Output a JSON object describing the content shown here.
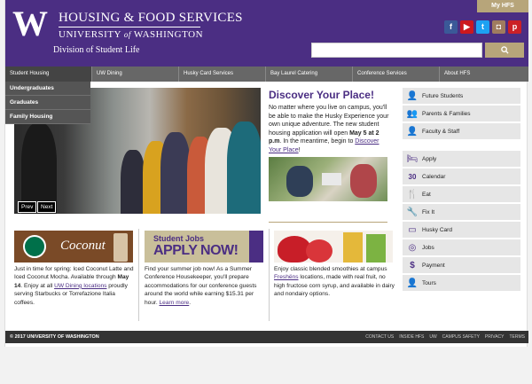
{
  "header": {
    "logo_letter": "W",
    "title": "HOUSING & FOOD SERVICES",
    "subtitle_a": "UNIVERSITY ",
    "subtitle_of": "of",
    "subtitle_b": " WASHINGTON",
    "division": "Division of Student Life",
    "my_hfs": "My HFS",
    "social": [
      {
        "name": "facebook-icon",
        "glyph": "f",
        "color": "#3b5998"
      },
      {
        "name": "youtube-icon",
        "glyph": "▶",
        "color": "#cc181e"
      },
      {
        "name": "twitter-icon",
        "glyph": "t",
        "color": "#1da1f2"
      },
      {
        "name": "instagram-icon",
        "glyph": "◘",
        "color": "#a07c5f"
      },
      {
        "name": "pinterest-icon",
        "glyph": "p",
        "color": "#cb2027"
      }
    ],
    "search_placeholder": "",
    "search_icon": "search-icon"
  },
  "nav": {
    "items": [
      "Student Housing",
      "UW Dining",
      "Husky Card Services",
      "Bay Laurel Catering",
      "Conference Services",
      "About HFS"
    ],
    "dropdown": [
      "Undergraduates",
      "Graduates",
      "Family Housing"
    ]
  },
  "hero": {
    "prev": "Prev",
    "next": "Next"
  },
  "discover": {
    "title": "Discover Your Place!",
    "text_1": "No matter where you live on campus, you'll be able to make the Husky Experience your own unique adventure. The new student housing application will open ",
    "date": "May 5 at 2 p.m",
    "text_2": ". In the meantime, begin to ",
    "link": "Discover Your Place",
    "text_3": "!"
  },
  "links_a": [
    {
      "label": "Future Students",
      "icon": "person-icon",
      "glyph": "👤"
    },
    {
      "label": "Parents & Families",
      "icon": "family-icon",
      "glyph": "👥"
    },
    {
      "label": "Faculty & Staff",
      "icon": "staff-icon",
      "glyph": "👤"
    }
  ],
  "links_b": [
    {
      "label": "Apply",
      "icon": "bed-icon",
      "glyph": "🛏"
    },
    {
      "label": "Calendar",
      "icon": "calendar-icon",
      "glyph": "30"
    },
    {
      "label": "Eat",
      "icon": "utensils-icon",
      "glyph": "🍴"
    },
    {
      "label": "Fix It",
      "icon": "wrench-icon",
      "glyph": "🔧"
    },
    {
      "label": "Husky Card",
      "icon": "card-icon",
      "glyph": "▭"
    },
    {
      "label": "Jobs",
      "icon": "target-icon",
      "glyph": "◎"
    },
    {
      "label": "Payment",
      "icon": "dollar-icon",
      "glyph": "$"
    },
    {
      "label": "Tours",
      "icon": "person-walk-icon",
      "glyph": "👤"
    }
  ],
  "promos": {
    "p1_banner": "Coconut",
    "p1_text_a": "Just in time for spring: Iced Coconut Latte and Iced Coconut Mocha. Available through ",
    "p1_bold": "May 14",
    "p1_text_b": ". Enjoy at all ",
    "p1_link": "UW Dining locations",
    "p1_text_c": " proudly serving Starbucks or Torrefazione Italia coffees.",
    "p2_line1": "Student Jobs",
    "p2_line2": "APPLY NOW!",
    "p2_text_a": "Find your summer job now! As a Summer Conference Housekeeper, you'll prepare accommodations for our conference guests around the world while earning $15.31 per hour. ",
    "p2_link": "Learn more",
    "p2_text_b": ".",
    "p3_text_a": "Enjoy classic blended smoothies at campus ",
    "p3_link": "Freshëns",
    "p3_text_b": " locations, made with real fruit, no high fructose corn syrup, and available in dairy and nondairy options."
  },
  "footer": {
    "copyright": "© 2017 UNIVERSITY OF WASHINGTON",
    "links": [
      "CONTACT US",
      "INSIDE HFS",
      "UW",
      "CAMPUS SAFETY",
      "PRIVACY",
      "TERMS"
    ]
  }
}
